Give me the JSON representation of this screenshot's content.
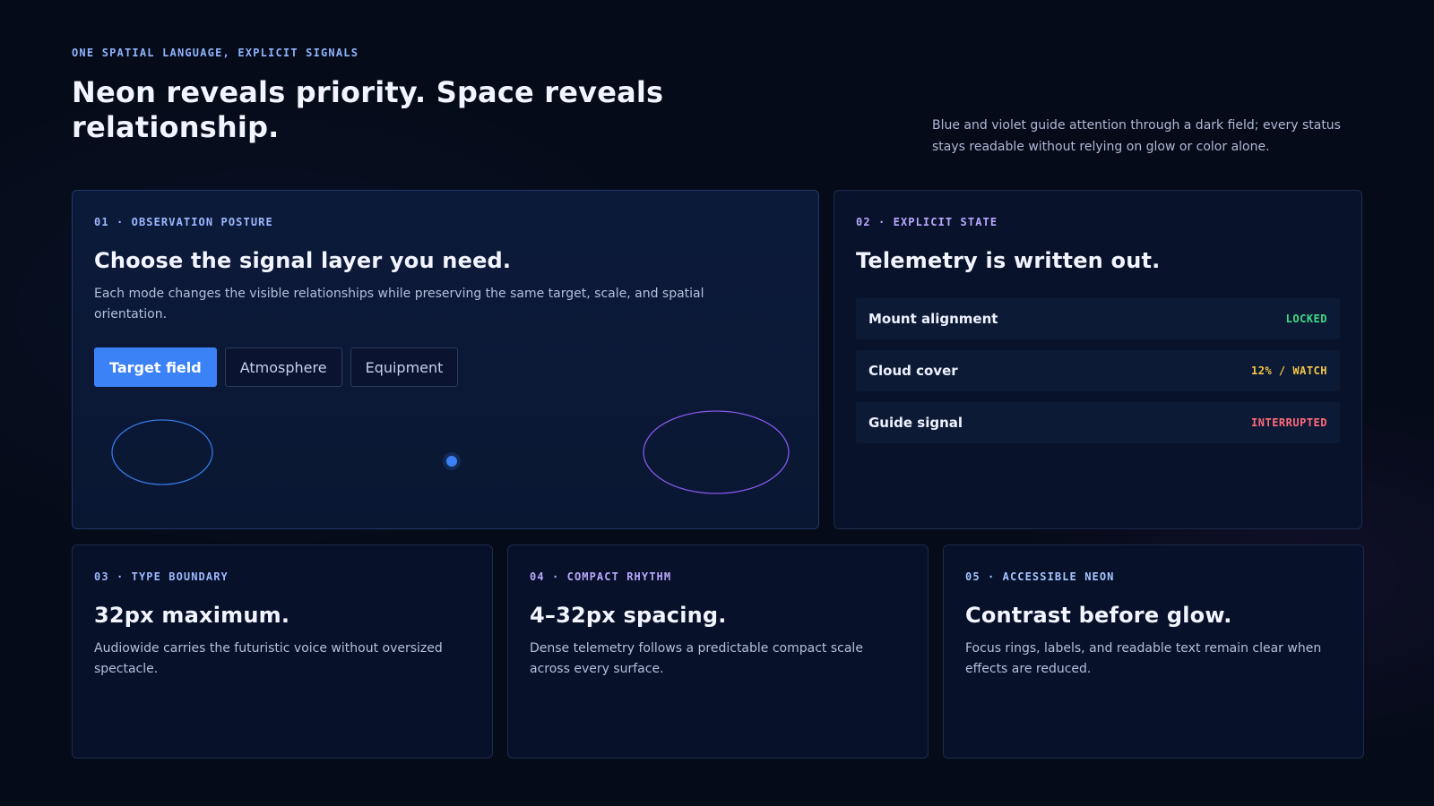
{
  "header": {
    "eyebrow": "ONE SPATIAL LANGUAGE, EXPLICIT SIGNALS",
    "title": "Neon reveals priority. Space reveals relationship.",
    "description": "Blue and violet guide attention through a dark field; every status stays readable without relying on glow or color alone."
  },
  "observation": {
    "kicker": "01 · OBSERVATION POSTURE",
    "title": "Choose the signal layer you need.",
    "body": "Each mode changes the visible relationships while preserving the same target, scale, and spatial orientation.",
    "modes": [
      {
        "label": "Target field",
        "active": true
      },
      {
        "label": "Atmosphere",
        "active": false
      },
      {
        "label": "Equipment",
        "active": false
      }
    ]
  },
  "state": {
    "kicker": "02 · EXPLICIT STATE",
    "title": "Telemetry is written out.",
    "rows": [
      {
        "label": "Mount alignment",
        "status": "LOCKED",
        "color": "#3ddc84"
      },
      {
        "label": "Cloud cover",
        "status": "12% / WATCH",
        "color": "#f5c542"
      },
      {
        "label": "Guide signal",
        "status": "INTERRUPTED",
        "color": "#ff6b7a"
      }
    ]
  },
  "type_boundary": {
    "kicker": "03 · TYPE BOUNDARY",
    "title": "32px maximum.",
    "body": "Audiowide carries the futuristic voice without oversized spectacle."
  },
  "rhythm": {
    "kicker": "04 · COMPACT RHYTHM",
    "title": "4–32px spacing.",
    "body": "Dense telemetry follows a predictable compact scale across every surface."
  },
  "neon": {
    "kicker": "05 · ACCESSIBLE NEON",
    "title": "Contrast before glow.",
    "body": "Focus rings, labels, and readable text remain clear when effects are reduced."
  },
  "colors": {
    "accent_blue": "#3b82f6",
    "accent_violet": "#8b5cf6",
    "background": "#050b18"
  }
}
